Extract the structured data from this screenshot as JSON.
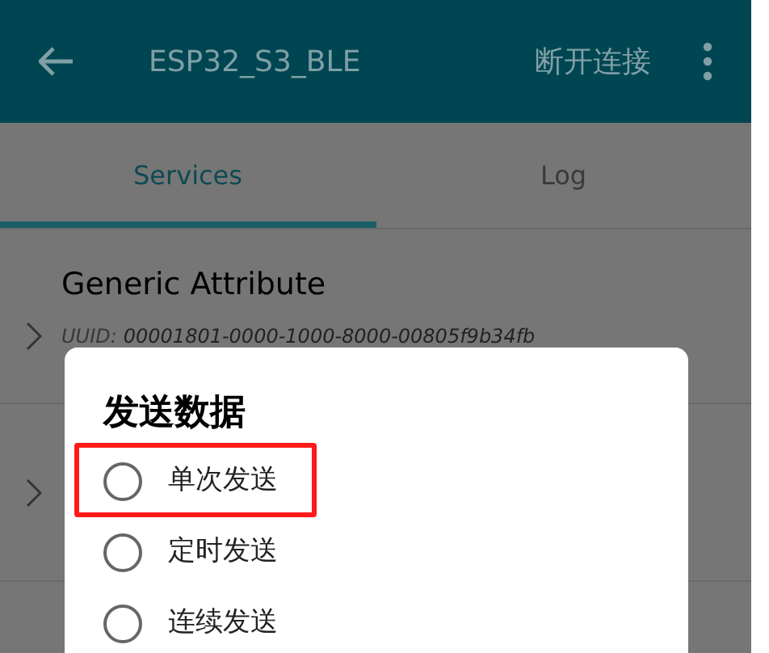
{
  "app_bar": {
    "title": "ESP32_S3_BLE",
    "action": "断开连接"
  },
  "tabs": [
    {
      "label": "Services",
      "selected": true
    },
    {
      "label": "Log",
      "selected": false
    }
  ],
  "services": [
    {
      "name": "Generic Attribute",
      "uuid_label": "UUID:",
      "uuid": "00001801-0000-1000-8000-00805f9b34fb"
    }
  ],
  "dialog": {
    "title": "发送数据",
    "options": [
      {
        "label": "单次发送",
        "selected": false,
        "highlighted": true
      },
      {
        "label": "定时发送",
        "selected": false,
        "highlighted": false
      },
      {
        "label": "连续发送",
        "selected": false,
        "highlighted": false
      }
    ]
  }
}
